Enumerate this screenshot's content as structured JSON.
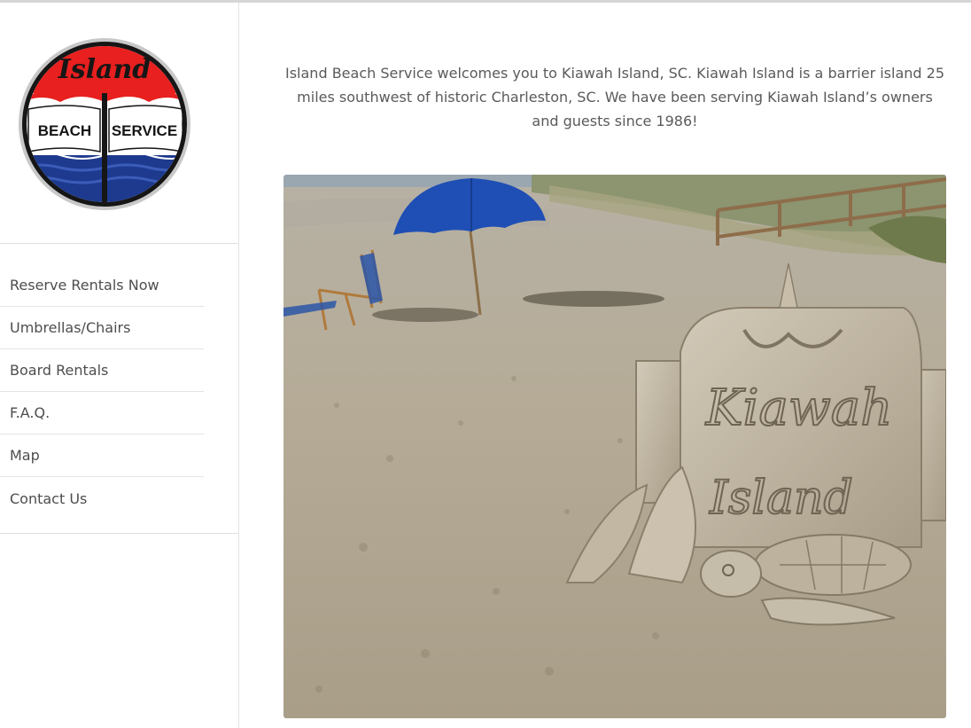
{
  "logo": {
    "script_text": "Island",
    "left_text": "BEACH",
    "right_text": "SERVICE",
    "colors": {
      "red": "#e8201f",
      "blue": "#1d3a8f",
      "ring": "#1a1a1a"
    }
  },
  "nav": {
    "items": [
      {
        "label": "Reserve Rentals Now"
      },
      {
        "label": "Umbrellas/Chairs"
      },
      {
        "label": "Board Rentals"
      },
      {
        "label": "F.A.Q."
      },
      {
        "label": "Map"
      },
      {
        "label": "Contact Us"
      }
    ]
  },
  "main": {
    "intro_text": "Island Beach Service welcomes you to Kiawah Island, SC.  Kiawah Island is a barrier island 25 miles southwest of historic Charleston, SC.  We have been serving Kiawah Island’s owners and guests since 1986!",
    "photo": {
      "sand_sculpture_line1": "Kiawah",
      "sand_sculpture_line2": "Island",
      "colors": {
        "sand": "#b8ad98",
        "umbrella": "#1f4fb5",
        "sky": "#9aa6b0"
      }
    }
  }
}
